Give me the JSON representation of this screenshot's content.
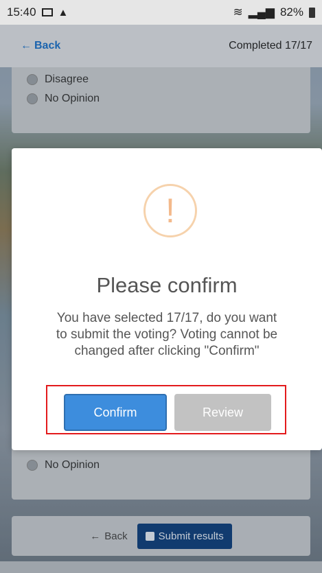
{
  "status_bar": {
    "time": "15:40",
    "battery": "82%",
    "icons": [
      "image-icon",
      "warning-icon",
      "wifi-icon",
      "signal-icon",
      "signal-icon",
      "battery-icon"
    ]
  },
  "header": {
    "back_label": "Back",
    "progress_text": "Completed 17/17"
  },
  "question_top": {
    "options": [
      "Disagree",
      "No Opinion"
    ]
  },
  "question_bottom": {
    "options": [
      "No Opinion"
    ]
  },
  "footer": {
    "back_label": "Back",
    "submit_label": "Submit results"
  },
  "modal": {
    "icon_glyph": "!",
    "title": "Please confirm",
    "message": "You have selected 17/17, do you want to submit the voting? Voting cannot be changed after clicking \"Confirm\"",
    "confirm_label": "Confirm",
    "review_label": "Review"
  },
  "colors": {
    "accent": "#3d8ddd",
    "submit": "#0d3d7a",
    "warning": "#f3b98b",
    "highlight": "#e3191b"
  }
}
